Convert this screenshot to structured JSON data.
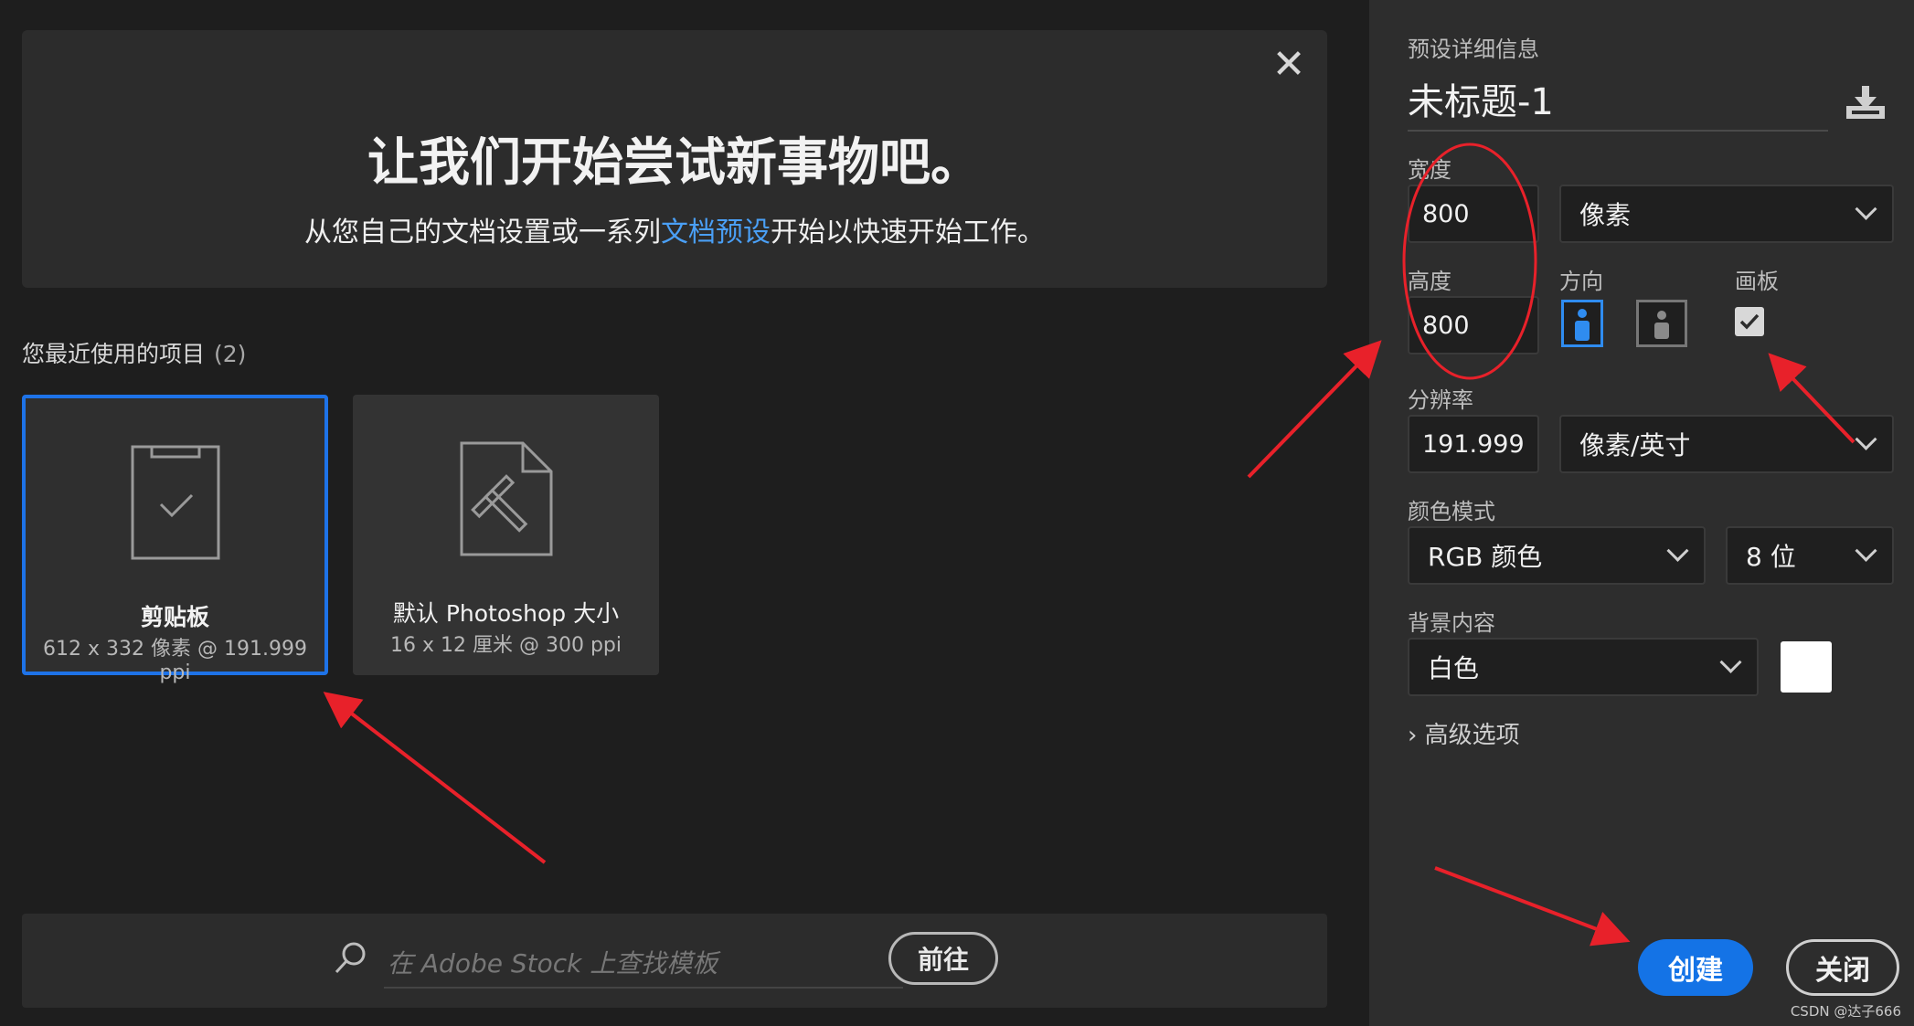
{
  "hero": {
    "title": "让我们开始尝试新事物吧。",
    "subtitle_before": "从您自己的文档设置或一系列",
    "subtitle_link": "文档预设",
    "subtitle_after": "开始以快速开始工作。",
    "close_glyph": "✕"
  },
  "recent": {
    "title": "您最近使用的项目",
    "count": "(2)",
    "items": [
      {
        "name": "剪贴板",
        "meta": "612 x 332 像素 @ 191.999 ppi",
        "icon": "clipboard-icon",
        "selected": true
      },
      {
        "name": "默认 Photoshop 大小",
        "meta": "16 x 12 厘米 @ 300 ppi",
        "icon": "document-ruler-icon",
        "selected": false
      }
    ]
  },
  "stock": {
    "placeholder": "在 Adobe Stock 上查找模板",
    "go_label": "前往"
  },
  "preset": {
    "section_title": "预设详细信息",
    "doc_name": "未标题-1",
    "width_label": "宽度",
    "width_value": "800",
    "width_unit": "像素",
    "height_label": "高度",
    "height_value": "800",
    "orientation_label": "方向",
    "artboard_label": "画板",
    "artboard_checked": true,
    "resolution_label": "分辨率",
    "resolution_value": "191.999",
    "resolution_unit": "像素/英寸",
    "color_mode_label": "颜色模式",
    "color_mode_value": "RGB 颜色",
    "bit_depth": "8 位",
    "background_label": "背景内容",
    "background_value": "白色",
    "background_color": "#ffffff",
    "advanced_label": "高级选项"
  },
  "actions": {
    "create_label": "创建",
    "close_label": "关闭"
  },
  "watermark": "CSDN @达子666",
  "colors": {
    "accent": "#1473e6",
    "link": "#4a9ff5",
    "annotation": "#e8212a"
  }
}
